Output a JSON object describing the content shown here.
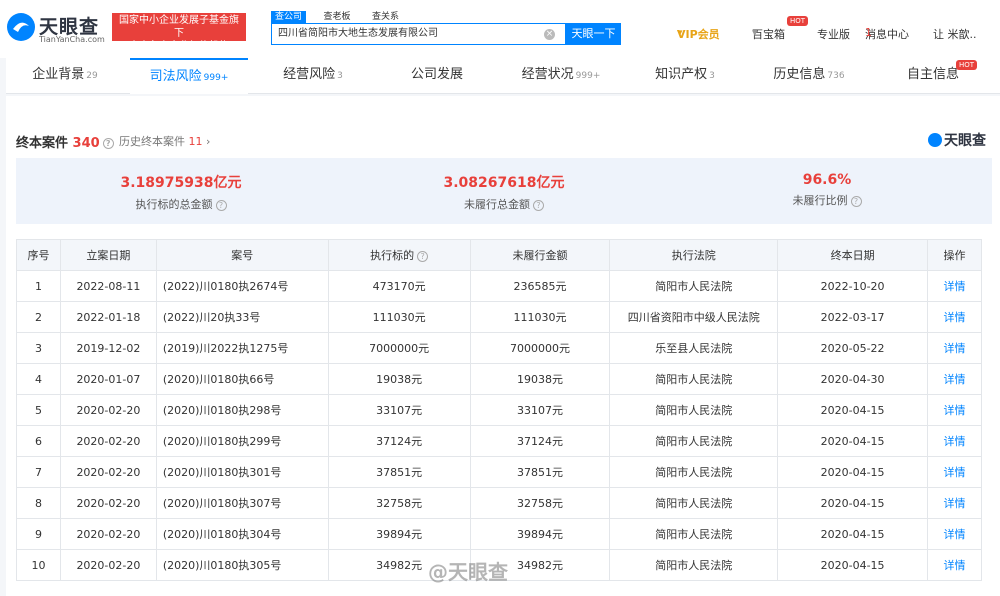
{
  "header": {
    "logo_name": "天眼查",
    "logo_sub": "TianYanCha.com",
    "badge_line1": "国家中小企业发展子基金旗下",
    "badge_line2": "官方备案企业征信机构",
    "search_tabs": [
      "查公司",
      "查老板",
      "查关系"
    ],
    "search_value": "四川省简阳市大地生态发展有限公司",
    "search_button": "天眼一下",
    "nav": {
      "vip": "VIP会员",
      "box": "百宝箱",
      "hot": "HOT",
      "pro": "专业版",
      "msg": "消息中心",
      "msg_count": "1",
      "user": "让 米歆.."
    }
  },
  "tabs": [
    {
      "label": "企业背景",
      "count": "29"
    },
    {
      "label": "司法风险",
      "count": "999+"
    },
    {
      "label": "经营风险",
      "count": "3"
    },
    {
      "label": "公司发展",
      "count": ""
    },
    {
      "label": "经营状况",
      "count": "999+"
    },
    {
      "label": "知识产权",
      "count": "3"
    },
    {
      "label": "历史信息",
      "count": "736"
    },
    {
      "label": "自主信息",
      "count": "",
      "hot": "HOT"
    }
  ],
  "section": {
    "title": "终本案件",
    "count": "340",
    "history_label": "历史终本案件",
    "history_count": "11",
    "brand": "天眼查"
  },
  "summary": [
    {
      "value": "3.18975938亿元",
      "label": "执行标的总金额"
    },
    {
      "value": "3.08267618亿元",
      "label": "未履行总金额"
    },
    {
      "value": "96.6%",
      "label": "未履行比例"
    }
  ],
  "table": {
    "headers": [
      "序号",
      "立案日期",
      "案号",
      "执行标的",
      "未履行金额",
      "执行法院",
      "终本日期",
      "操作"
    ],
    "rows": [
      [
        "1",
        "2022-08-11",
        "(2022)川0180执2674号",
        "473170元",
        "236585元",
        "简阳市人民法院",
        "2022-10-20",
        "详情"
      ],
      [
        "2",
        "2022-01-18",
        "(2022)川20执33号",
        "111030元",
        "111030元",
        "四川省资阳市中级人民法院",
        "2022-03-17",
        "详情"
      ],
      [
        "3",
        "2019-12-02",
        "(2019)川2022执1275号",
        "7000000元",
        "7000000元",
        "乐至县人民法院",
        "2020-05-22",
        "详情"
      ],
      [
        "4",
        "2020-01-07",
        "(2020)川0180执66号",
        "19038元",
        "19038元",
        "简阳市人民法院",
        "2020-04-30",
        "详情"
      ],
      [
        "5",
        "2020-02-20",
        "(2020)川0180执298号",
        "33107元",
        "33107元",
        "简阳市人民法院",
        "2020-04-15",
        "详情"
      ],
      [
        "6",
        "2020-02-20",
        "(2020)川0180执299号",
        "37124元",
        "37124元",
        "简阳市人民法院",
        "2020-04-15",
        "详情"
      ],
      [
        "7",
        "2020-02-20",
        "(2020)川0180执301号",
        "37851元",
        "37851元",
        "简阳市人民法院",
        "2020-04-15",
        "详情"
      ],
      [
        "8",
        "2020-02-20",
        "(2020)川0180执307号",
        "32758元",
        "32758元",
        "简阳市人民法院",
        "2020-04-15",
        "详情"
      ],
      [
        "9",
        "2020-02-20",
        "(2020)川0180执304号",
        "39894元",
        "39894元",
        "简阳市人民法院",
        "2020-04-15",
        "详情"
      ],
      [
        "10",
        "2020-02-20",
        "(2020)川0180执305号",
        "34982元",
        "34982元",
        "简阳市人民法院",
        "2020-04-15",
        "详情"
      ]
    ]
  },
  "watermark": "@天眼查",
  "colors": {
    "accent": "#0084ff",
    "alert": "#e8403b"
  }
}
